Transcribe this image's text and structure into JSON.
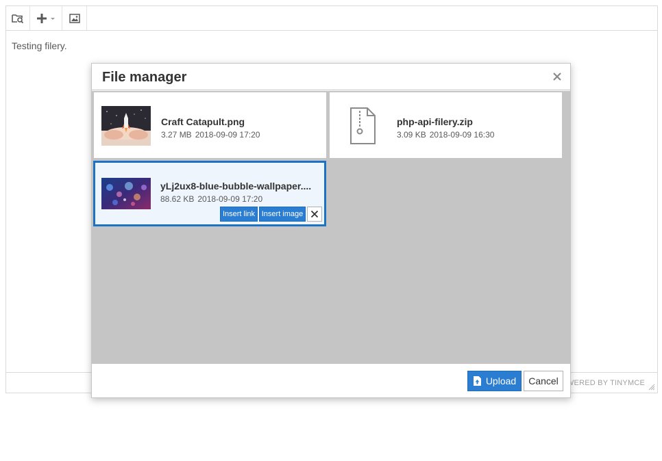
{
  "editor": {
    "content_text": "Testing filery.",
    "powered_by": "POWERED BY TINYMCE",
    "toolbar": {
      "buttons": [
        {
          "name": "file-search-icon"
        },
        {
          "name": "plus-icon"
        },
        {
          "name": "image-icon"
        }
      ]
    }
  },
  "dialog": {
    "title": "File manager",
    "close_icon": "close-icon",
    "files": [
      {
        "name": "Craft Catapult.png",
        "size": "3.27 MB",
        "date": "2018-09-09 17:20",
        "kind": "image"
      },
      {
        "name": "php-api-filery.zip",
        "size": "3.09 KB",
        "date": "2018-09-09 16:30",
        "kind": "zip"
      },
      {
        "name": "yLj2ux8-blue-bubble-wallpaper....",
        "size": "88.62 KB",
        "date": "2018-09-09 17:20",
        "kind": "image",
        "selected": true
      }
    ],
    "actions": {
      "insert_link": "Insert link",
      "insert_image": "Insert image"
    },
    "footer": {
      "upload": "Upload",
      "cancel": "Cancel"
    }
  },
  "colors": {
    "accent": "#2a7dd1",
    "selected_border": "#1e72c4",
    "selected_bg": "#eef5fd",
    "panel_bg": "#c5c5c5"
  }
}
